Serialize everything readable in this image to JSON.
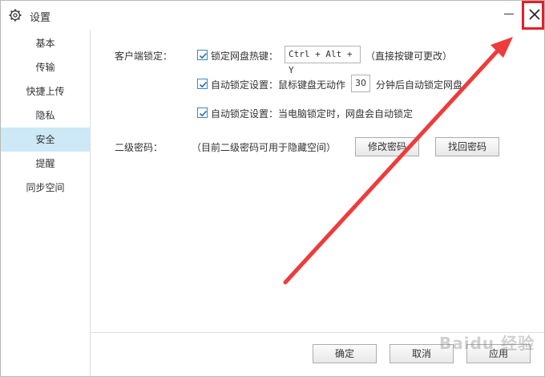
{
  "window": {
    "title": "设置",
    "icons": {
      "settings": "gear-icon",
      "minimize": "minimize-icon",
      "close": "close-icon"
    }
  },
  "sidebar": {
    "items": [
      {
        "label": "基本",
        "active": false
      },
      {
        "label": "传输",
        "active": false
      },
      {
        "label": "快捷上传",
        "active": false
      },
      {
        "label": "隐私",
        "active": false
      },
      {
        "label": "安全",
        "active": true
      },
      {
        "label": "提醒",
        "active": false
      },
      {
        "label": "同步空间",
        "active": false
      }
    ]
  },
  "security": {
    "client_lock_label": "客户端锁定：",
    "lock_hotkey": {
      "checked": true,
      "label": "锁定网盘热键：",
      "value": "Ctrl + Alt + Y",
      "hint": "（直接按键可更改）"
    },
    "auto_lock_idle": {
      "checked": true,
      "label": "自动锁定设置：鼠标键盘无动作",
      "minutes": "30",
      "suffix": "分钟后自动锁定网盘"
    },
    "auto_lock_pc": {
      "checked": true,
      "label": "自动锁定设置：当电脑锁定时，网盘会自动锁定"
    },
    "second_password_label": "二级密码：",
    "second_password_hint": "（目前二级密码可用于隐藏空间）",
    "modify_password_button": "修改密码",
    "recover_password_button": "找回密码"
  },
  "footer": {
    "ok": "确定",
    "cancel": "取消",
    "apply": "应用"
  },
  "watermark": "Baidu 经验",
  "colors": {
    "accent": "#3a86c8",
    "active_bg": "#cde8f6",
    "highlight": "#e0202a"
  }
}
